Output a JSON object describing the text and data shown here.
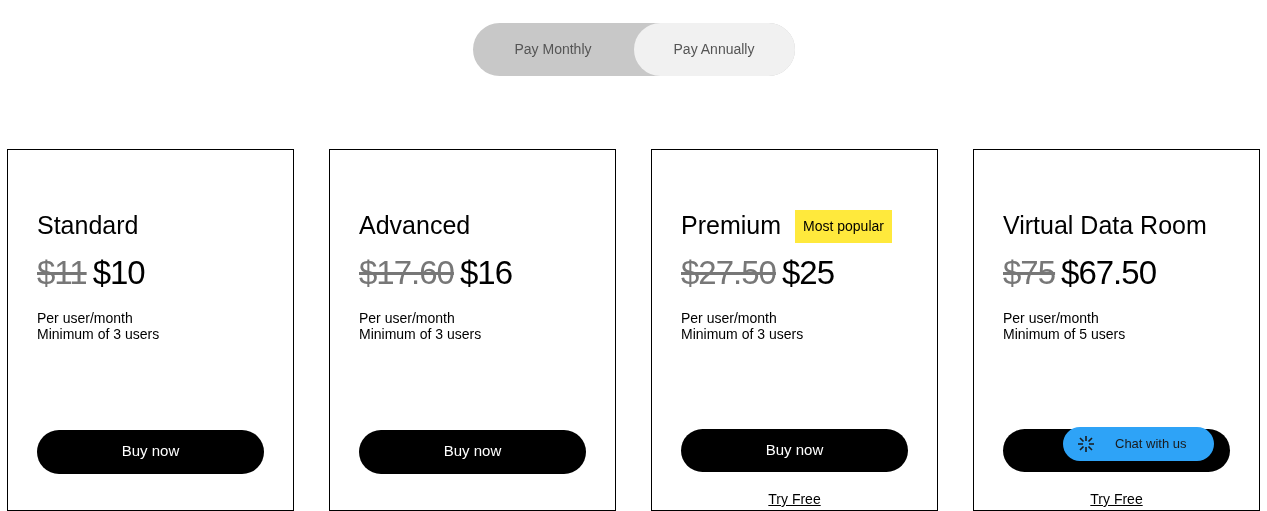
{
  "billing_toggle": [
    {
      "label": "Pay Monthly",
      "selected": false
    },
    {
      "label": "Pay Annually",
      "selected": true
    }
  ],
  "plans": [
    {
      "name": "Standard",
      "old_price": "$11",
      "price": "$10",
      "per": "Per user/month",
      "minimum": "Minimum of 3 users",
      "buy_label": "Buy now"
    },
    {
      "name": "Advanced",
      "old_price": "$17.60",
      "price": "$16",
      "per": "Per user/month",
      "minimum": "Minimum of 3 users",
      "buy_label": "Buy now"
    },
    {
      "name": "Premium",
      "badge": "Most popular",
      "old_price": "$27.50",
      "price": "$25",
      "per": "Per user/month",
      "minimum": "Minimum of 3 users",
      "buy_label": "Buy now",
      "try_link": "Try Free"
    },
    {
      "name": "Virtual Data Room",
      "old_price": "$75",
      "price": "$67.50",
      "per": "Per user/month",
      "minimum": "Minimum of 5 users",
      "try_link": "Try Free"
    }
  ],
  "chat_widget": {
    "label": "Chat with us"
  }
}
